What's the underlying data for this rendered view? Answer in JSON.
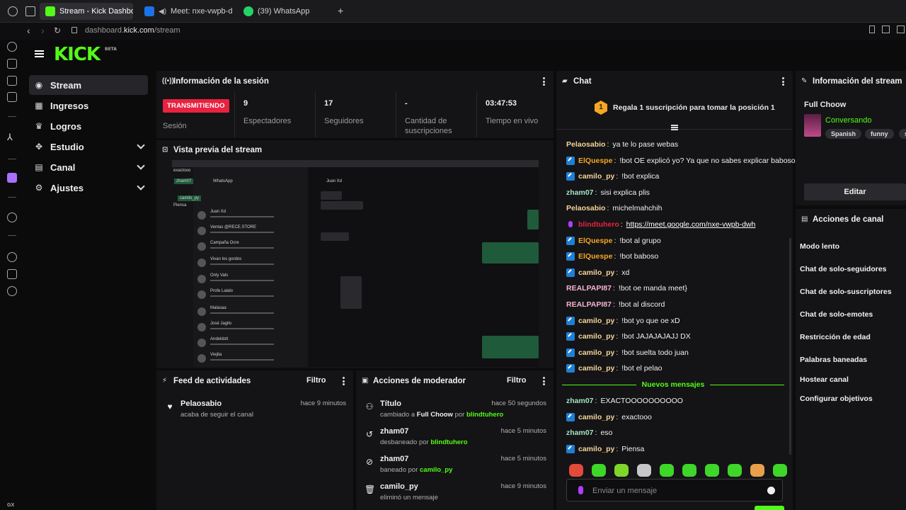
{
  "browser": {
    "tabs": [
      {
        "label": "Stream - Kick Dashboard",
        "active": true,
        "color": "#53fc18"
      },
      {
        "label": "Meet: nxe-vwpb-d",
        "active": false,
        "color": "#1a73e8"
      },
      {
        "label": "(39) WhatsApp",
        "active": false,
        "color": "#25d366"
      }
    ],
    "url_prefix": "dashboard.",
    "url_domain": "kick.com",
    "url_path": "/stream"
  },
  "logo": {
    "text": "KICK",
    "badge": "BETA"
  },
  "nav": [
    {
      "label": "Stream",
      "icon": "broadcast-icon",
      "active": true,
      "expandable": false
    },
    {
      "label": "Ingresos",
      "icon": "chart-icon",
      "active": false,
      "expandable": false
    },
    {
      "label": "Logros",
      "icon": "trophy-icon",
      "active": false,
      "expandable": false
    },
    {
      "label": "Estudio",
      "icon": "studio-icon",
      "active": false,
      "expandable": true
    },
    {
      "label": "Canal",
      "icon": "channel-icon",
      "active": false,
      "expandable": true
    },
    {
      "label": "Ajustes",
      "icon": "gear-icon",
      "active": false,
      "expandable": true
    }
  ],
  "session": {
    "title": "Información de la sesión",
    "status": "TRANSMITIENDO",
    "status_label": "Sesión",
    "stats": [
      {
        "value": "9",
        "label": "Espectadores"
      },
      {
        "value": "17",
        "label": "Seguidores"
      },
      {
        "value": "-",
        "label": "Cantidad de suscripciones"
      },
      {
        "value": "03:47:53",
        "label": "Tiempo en vivo"
      }
    ]
  },
  "preview": {
    "title": "Vista previa del stream",
    "overlay_users": [
      "exactooo",
      "zham07",
      "camilo_py",
      "Piensa"
    ],
    "app_title": "WhatsApp",
    "contact": "Juan Xd",
    "contacts": [
      "Juan Xd",
      "Ventas @RECE.STORE",
      "Campaña Ocre",
      "Vivan los gordos",
      "Only Vals",
      "Profe Lalalo",
      "Malasaa",
      "José Jagilo",
      "Andeldott",
      "Viejita"
    ]
  },
  "chat": {
    "title": "Chat",
    "gift_rank": "1",
    "gift_text": "Regala 1 suscripción para tomar la posición 1",
    "messages": [
      {
        "user": "Pelaosabio",
        "text": "ya te lo pase webas",
        "color": "#f5d49a",
        "badge": ""
      },
      {
        "user": "ElQuespe",
        "text": "!bot OE explicó yo? Ya que no sabes explicar baboso",
        "color": "#f5a623",
        "badge": "mod"
      },
      {
        "user": "camilo_py",
        "text": "!bot explica",
        "color": "#f5d49a",
        "badge": "mod"
      },
      {
        "user": "zham07",
        "text": "sisi explica plis",
        "color": "#a6e3c0",
        "badge": ""
      },
      {
        "user": "Pelaosabio",
        "text": "michelmahchih",
        "color": "#f5d49a",
        "badge": ""
      },
      {
        "user": "blindtuhero",
        "text": "https://meet.google.com/nxe-vwpb-dwh",
        "color": "#e8223f",
        "badge": "mic",
        "link": true
      },
      {
        "user": "ElQuespe",
        "text": "!bot al grupo",
        "color": "#f5a623",
        "badge": "mod"
      },
      {
        "user": "ElQuespe",
        "text": "!bot baboso",
        "color": "#f5a623",
        "badge": "mod"
      },
      {
        "user": "camilo_py",
        "text": "xd",
        "color": "#f5d49a",
        "badge": "mod"
      },
      {
        "user": "REALPAPI87",
        "text": "!bot oe manda meet}",
        "color": "#f7b3cf",
        "badge": ""
      },
      {
        "user": "REALPAPI87",
        "text": "!bot al discord",
        "color": "#f7b3cf",
        "badge": ""
      },
      {
        "user": "camilo_py",
        "text": "!bot yo que oe xD",
        "color": "#f5d49a",
        "badge": "mod"
      },
      {
        "user": "camilo_py",
        "text": "!bot JAJAJAJAJJ DX",
        "color": "#f5d49a",
        "badge": "mod"
      },
      {
        "user": "camilo_py",
        "text": "!bot suelta todo juan",
        "color": "#f5d49a",
        "badge": "mod"
      },
      {
        "user": "camilo_py",
        "text": "!bot el pelao",
        "color": "#f5d49a",
        "badge": "mod"
      }
    ],
    "new_messages_label": "Nuevos mensajes",
    "new_messages": [
      {
        "user": "zham07",
        "text": "EXACTOOOOOOOOOO",
        "color": "#a6e3c0",
        "badge": ""
      },
      {
        "user": "camilo_py",
        "text": "exactooo",
        "color": "#f5d49a",
        "badge": "mod"
      },
      {
        "user": "zham07",
        "text": "eso",
        "color": "#a6e3c0",
        "badge": ""
      },
      {
        "user": "camilo_py",
        "text": "Piensa",
        "color": "#f5d49a",
        "badge": "mod"
      }
    ],
    "input_placeholder": "Enviar un mensaje"
  },
  "activity": {
    "title": "Feed de actividades",
    "filter": "Filtro",
    "items": [
      {
        "icon": "heart-icon",
        "user": "Pelaosabio",
        "text": "acaba de seguir el canal",
        "time": "hace 9 minutos"
      }
    ]
  },
  "mod_actions": {
    "title": "Acciones de moderador",
    "filter": "Filtro",
    "items": [
      {
        "icon": "users-icon",
        "glyph": "⚇",
        "title": "Título",
        "pre": "cambiado a",
        "target": "Full Choow",
        "mid": "por",
        "actor": "blindtuhero",
        "time": "hace 50 segundos"
      },
      {
        "icon": "unban-icon",
        "glyph": "↺",
        "title": "zham07",
        "pre": "desbaneado por",
        "target": "",
        "mid": "",
        "actor": "blindtuhero",
        "time": "hace 5 minutos"
      },
      {
        "icon": "ban-icon",
        "glyph": "⊘",
        "title": "zham07",
        "pre": "baneado por",
        "target": "",
        "mid": "",
        "actor": "camilo_py",
        "time": "hace 5 minutos"
      },
      {
        "icon": "trash-icon",
        "glyph": "🗑",
        "title": "camilo_py",
        "pre": "eliminó un mensaje",
        "target": "",
        "mid": "",
        "actor": "",
        "time": "hace 9 minutos"
      }
    ]
  },
  "stream_info": {
    "title": "Información del stream",
    "stream_title": "Full Choow",
    "category": "Conversando",
    "tags": [
      "Spanish",
      "funny",
      "spa"
    ],
    "edit": "Editar"
  },
  "channel_actions": {
    "title": "Acciones de canal",
    "items": [
      "Modo lento",
      "Chat de solo-seguidores",
      "Chat de solo-suscriptores",
      "Chat de solo-emotes",
      "Restricción de edad",
      "Palabras baneadas",
      "Hostear canal",
      "Configurar objetivos"
    ]
  },
  "bottom_left_label": "GX"
}
